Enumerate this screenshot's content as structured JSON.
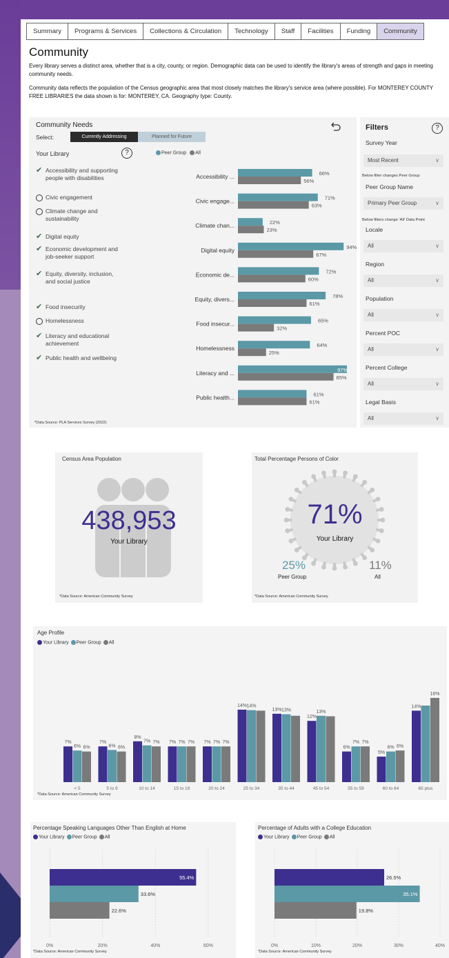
{
  "tabs": [
    "Summary",
    "Programs & Services",
    "Collections & Circulation",
    "Technology",
    "Staff",
    "Facilities",
    "Funding",
    "Community"
  ],
  "title": "Community",
  "intro1": "Every library serves a distinct area, whether that is a city, county, or region. Demographic data can be used to identify the library's areas of strength and gaps in meeting community needs.",
  "intro2": "Community data reflects the population of the Census geographic area that most closely matches the library's service area (where possible). For MONTEREY COUNTY FREE LIBRARIES the data shown is for: MONTEREY, CA. Geography type: County.",
  "needs": {
    "title": "Community Needs",
    "select_label": "Select:",
    "btn_current": "Currently Addressing",
    "btn_future": "Planned for Future",
    "your_library": "Your Library",
    "legend_peer": "Peer Group",
    "legend_all": "All",
    "source": "*Data Source: PLA Services Survey (2022)",
    "items": [
      {
        "label": "Accessibility and supporting people with disabilities",
        "checked": true
      },
      {
        "label": "Civic engagement",
        "checked": false
      },
      {
        "label": "Climate change and sustainability",
        "checked": false
      },
      {
        "label": "Digital equity",
        "checked": true
      },
      {
        "label": "Economic development and job-seeker support",
        "checked": true
      },
      {
        "label": "Equity, diversity, inclusion, and social justice",
        "checked": true
      },
      {
        "label": "Food insecurity",
        "checked": true
      },
      {
        "label": "Homelessness",
        "checked": false
      },
      {
        "label": "Literacy and educational achievement",
        "checked": true
      },
      {
        "label": "Public health and wellbeing",
        "checked": true
      }
    ],
    "chart_labels": [
      "Accessibility ...",
      "Civic engage...",
      "Climate chan...",
      "Digital equity",
      "Economic de...",
      "Equity, divers...",
      "Food insecur...",
      "Homelessness",
      "Literacy and ...",
      "Public health..."
    ],
    "peer": [
      66,
      71,
      22,
      94,
      72,
      78,
      65,
      64,
      97,
      61
    ],
    "all": [
      56,
      63,
      23,
      67,
      60,
      61,
      32,
      25,
      85,
      61
    ],
    "peer_labels": [
      "66%",
      "71%",
      "22%",
      "94%",
      "72%",
      "78%",
      "65%",
      "64%",
      "97%",
      "61%"
    ],
    "all_labels": [
      "56%",
      "63%",
      "23%",
      "67%",
      "60%",
      "61%",
      "32%",
      "25%",
      "85%",
      "61%"
    ]
  },
  "filters": {
    "title": "Filters",
    "survey_year": "Survey Year",
    "survey_year_val": "Most Recent",
    "note1": "Below filter changes Peer Group",
    "peer_group_name": "Peer Group Name",
    "peer_group_val": "Primary Peer Group",
    "note2": "Below filters change 'All' Data Point",
    "locale": "Locale",
    "region": "Region",
    "population": "Population",
    "percent_poc": "Percent POC",
    "percent_college": "Percent College",
    "legal_basis": "Legal Basis",
    "all_val": "All"
  },
  "population": {
    "title": "Census Area Population",
    "value": "438,953",
    "sub": "Your Library",
    "source": "*Data Source: American Community Survey"
  },
  "poc": {
    "title": "Total Percentage Persons of Color",
    "value": "71%",
    "sub": "Your Library",
    "peer": "25%",
    "peer_label": "Peer Group",
    "all": "11%",
    "all_label": "All",
    "source": "*Data Source: American Community Survey"
  },
  "age": {
    "title": "Age Profile",
    "legend": [
      "Your Library",
      "Peer Group",
      "All"
    ],
    "source": "*Data Source: American Community Survey"
  },
  "lang": {
    "title": "Percentage Speaking Languages Other Than English at Home",
    "legend": [
      "Your Library",
      "Peer Group",
      "All"
    ],
    "source": "*Data Source: American Community Survey",
    "ticks": [
      "0%",
      "20%",
      "40%",
      "60%"
    ]
  },
  "college": {
    "title": "Percentage of Adults with a College Education",
    "legend": [
      "Your Library",
      "Peer Group",
      "All"
    ],
    "source": "*Data Source: American Community Survey",
    "ticks": [
      "0%",
      "10%",
      "20%",
      "30%",
      "40%"
    ]
  },
  "colors": {
    "your": "#3d2f8f",
    "peer": "#5b99a6",
    "all": "#7a7a7a"
  },
  "chart_data": [
    {
      "type": "bar",
      "title": "Community Needs",
      "categories": [
        "Accessibility ...",
        "Civic engage...",
        "Climate chan...",
        "Digital equity",
        "Economic de...",
        "Equity, divers...",
        "Food insecur...",
        "Homelessness",
        "Literacy and ...",
        "Public health..."
      ],
      "series": [
        {
          "name": "Peer Group",
          "values": [
            66,
            71,
            22,
            94,
            72,
            78,
            65,
            64,
            97,
            61
          ]
        },
        {
          "name": "All",
          "values": [
            56,
            63,
            23,
            67,
            60,
            61,
            32,
            25,
            85,
            61
          ]
        }
      ]
    },
    {
      "type": "bar",
      "title": "Age Profile",
      "categories": [
        "< 5",
        "5 to 9",
        "10 to 14",
        "15 to 19",
        "20 to 24",
        "25 to 34",
        "35 to 44",
        "45 to 54",
        "55 to 59",
        "60 to 64",
        "65 plus"
      ],
      "series": [
        {
          "name": "Your Library",
          "values": [
            7,
            7,
            8,
            7,
            7,
            14,
            13,
            12,
            6,
            5,
            14
          ]
        },
        {
          "name": "Peer Group",
          "values": [
            6,
            6,
            7,
            7,
            7,
            14,
            13,
            13,
            7,
            6,
            null
          ]
        },
        {
          "name": "All",
          "values": [
            6,
            6,
            7,
            7,
            7,
            null,
            null,
            null,
            7,
            6,
            16
          ]
        }
      ]
    },
    {
      "type": "bar",
      "title": "Percentage Speaking Languages Other Than English at Home",
      "categories": [
        "Your Library",
        "Peer Group",
        "All"
      ],
      "values": [
        55.4,
        33.6,
        22.6
      ],
      "xlim": [
        0,
        60
      ]
    },
    {
      "type": "bar",
      "title": "Percentage of Adults with a College Education",
      "categories": [
        "Your Library",
        "Peer Group",
        "All"
      ],
      "values": [
        26.5,
        35.1,
        19.8
      ],
      "xlim": [
        0,
        40
      ]
    }
  ]
}
